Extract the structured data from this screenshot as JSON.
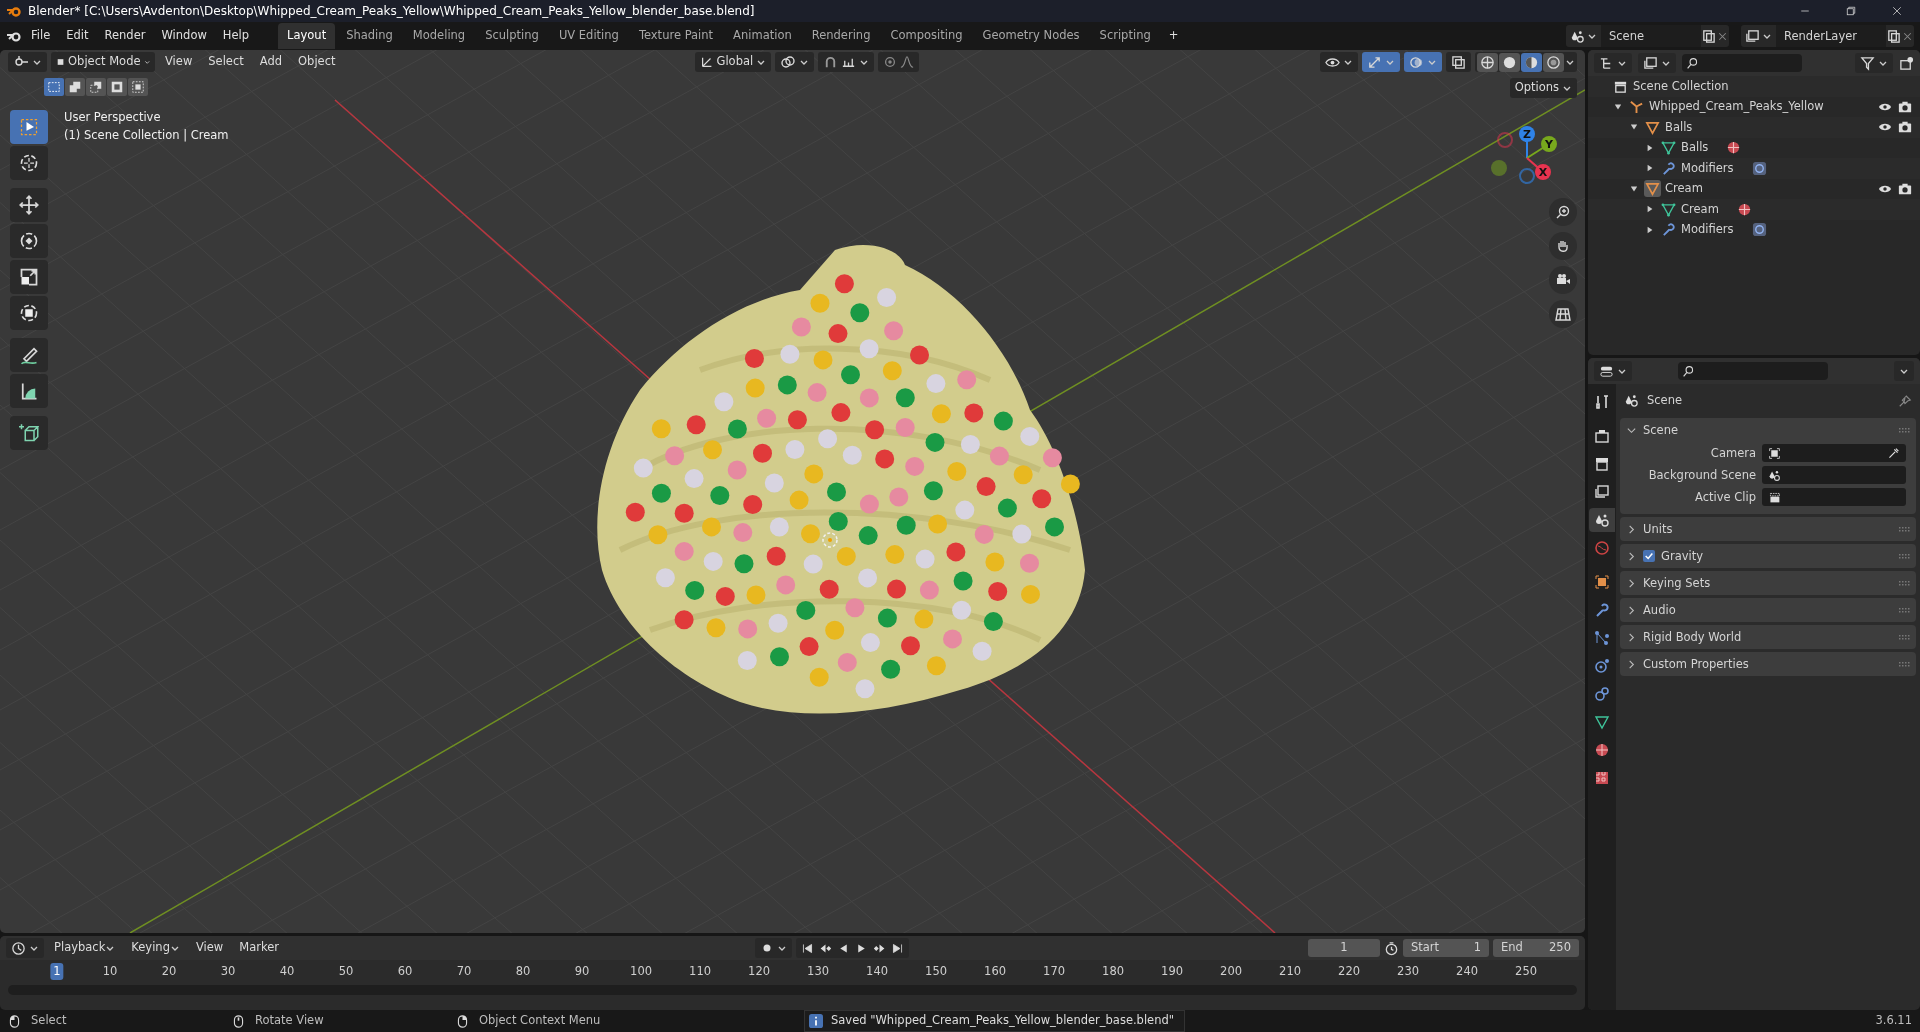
{
  "window": {
    "title": "Blender* [C:\\Users\\Avdenton\\Desktop\\Whipped_Cream_Peaks_Yellow\\Whipped_Cream_Peaks_Yellow_blender_base.blend]"
  },
  "menu": [
    "File",
    "Edit",
    "Render",
    "Window",
    "Help"
  ],
  "workspaces": [
    {
      "label": "Layout",
      "selected": true
    },
    {
      "label": "Shading",
      "selected": false
    },
    {
      "label": "Modeling",
      "selected": false
    },
    {
      "label": "Sculpting",
      "selected": false
    },
    {
      "label": "UV Editing",
      "selected": false
    },
    {
      "label": "Texture Paint",
      "selected": false
    },
    {
      "label": "Animation",
      "selected": false
    },
    {
      "label": "Rendering",
      "selected": false
    },
    {
      "label": "Compositing",
      "selected": false
    },
    {
      "label": "Geometry Nodes",
      "selected": false
    },
    {
      "label": "Scripting",
      "selected": false
    }
  ],
  "workspace_add": "+",
  "scene_selector": {
    "value": "Scene"
  },
  "view_layer_selector": {
    "value": "RenderLayer"
  },
  "viewport": {
    "mode": "Object Mode",
    "menus": [
      "View",
      "Select",
      "Add",
      "Object"
    ],
    "transform_orientation": "Global",
    "options": "Options",
    "select_modes": [
      {
        "kind": "set",
        "selected": true
      },
      {
        "kind": "extend",
        "selected": false
      },
      {
        "kind": "subtract",
        "selected": false
      },
      {
        "kind": "invert",
        "selected": false
      },
      {
        "kind": "intersect",
        "selected": false
      }
    ],
    "toggles": [
      {
        "kind": "gizmos",
        "on": true
      },
      {
        "kind": "overlays",
        "on": true
      },
      {
        "kind": "xray",
        "on": false
      }
    ],
    "shading": [
      {
        "kind": "wireframe",
        "selected": false
      },
      {
        "kind": "solid",
        "selected": false
      },
      {
        "kind": "material",
        "selected": true
      },
      {
        "kind": "rendered",
        "selected": false
      }
    ],
    "overlay_text": [
      "User Perspective",
      "(1) Scene Collection | Cream"
    ],
    "tools": [
      {
        "kind": "select",
        "selected": true
      },
      {
        "kind": "cursor",
        "selected": false
      },
      {
        "kind": "move",
        "selected": false
      },
      {
        "kind": "rotate",
        "selected": false
      },
      {
        "kind": "scale",
        "selected": false
      },
      {
        "kind": "transform",
        "selected": false
      },
      {
        "kind": "annotate",
        "selected": false
      },
      {
        "kind": "measure",
        "selected": false
      },
      {
        "kind": "add-cube",
        "selected": false
      }
    ],
    "gizmo": [
      {
        "label": "Z",
        "color": "#2f83e8"
      },
      {
        "label": "Y",
        "color": "#78a81d"
      },
      {
        "label": "X",
        "color": "#e8334f"
      }
    ]
  },
  "outliner": {
    "items": [
      {
        "label": "Scene Collection",
        "kind": "collection",
        "children": [
          {
            "label": "Whipped_Cream_Peaks_Yellow",
            "kind": "empty",
            "expanded": true,
            "children": [
              {
                "label": "Balls",
                "kind": "mesh-object",
                "expanded": true,
                "active": false,
                "children": [
                  {
                    "label": "Balls",
                    "kind": "mesh-data",
                    "expanded": false
                  },
                  {
                    "label": "Modifiers",
                    "kind": "modifiers",
                    "expanded": false
                  }
                ]
              },
              {
                "label": "Cream",
                "kind": "mesh-object",
                "expanded": true,
                "active": true,
                "children": [
                  {
                    "label": "Cream",
                    "kind": "mesh-data",
                    "expanded": false
                  },
                  {
                    "label": "Modifiers",
                    "kind": "modifiers",
                    "expanded": false
                  }
                ]
              }
            ]
          }
        ]
      }
    ]
  },
  "properties": {
    "tabs": [
      {
        "kind": "tool",
        "selected": false
      },
      {
        "kind": "render",
        "selected": false
      },
      {
        "kind": "output",
        "selected": false
      },
      {
        "kind": "view-layer",
        "selected": false
      },
      {
        "kind": "scene",
        "selected": true
      },
      {
        "kind": "world",
        "selected": false
      },
      {
        "kind": "object",
        "selected": false
      },
      {
        "kind": "modifiers",
        "selected": false
      },
      {
        "kind": "particles",
        "selected": false
      },
      {
        "kind": "physics",
        "selected": false
      },
      {
        "kind": "constraints",
        "selected": false
      },
      {
        "kind": "data",
        "selected": false
      },
      {
        "kind": "material",
        "selected": false
      },
      {
        "kind": "texture",
        "selected": false
      }
    ],
    "context": "Scene",
    "panels": [
      {
        "label": "Scene",
        "kind": "panel",
        "expanded": true,
        "fields": [
          {
            "label": "Camera",
            "kind": "camera"
          },
          {
            "label": "Background Scene",
            "kind": "scene"
          },
          {
            "label": "Active Clip",
            "kind": "clip"
          }
        ]
      },
      {
        "label": "Units",
        "kind": "panel",
        "expanded": false
      },
      {
        "label": "Gravity",
        "kind": "checkbox-panel",
        "expanded": false,
        "checked": true
      },
      {
        "label": "Keying Sets",
        "kind": "panel",
        "expanded": false
      },
      {
        "label": "Audio",
        "kind": "panel",
        "expanded": false
      },
      {
        "label": "Rigid Body World",
        "kind": "panel",
        "expanded": false
      },
      {
        "label": "Custom Properties",
        "kind": "panel",
        "expanded": false
      }
    ]
  },
  "timeline": {
    "menus": [
      "Playback",
      "Keying",
      "View",
      "Marker"
    ],
    "current_frame": "1",
    "start": {
      "label": "Start",
      "value": "1"
    },
    "end": {
      "label": "End",
      "value": "250"
    },
    "ruler": [
      {
        "label": "1",
        "selected": true
      },
      {
        "label": "10",
        "selected": false
      },
      {
        "label": "20",
        "selected": false
      },
      {
        "label": "30",
        "selected": false
      },
      {
        "label": "40",
        "selected": false
      },
      {
        "label": "50",
        "selected": false
      },
      {
        "label": "60",
        "selected": false
      },
      {
        "label": "70",
        "selected": false
      },
      {
        "label": "80",
        "selected": false
      },
      {
        "label": "90",
        "selected": false
      },
      {
        "label": "100",
        "selected": false
      },
      {
        "label": "110",
        "selected": false
      },
      {
        "label": "120",
        "selected": false
      },
      {
        "label": "130",
        "selected": false
      },
      {
        "label": "140",
        "selected": false
      },
      {
        "label": "150",
        "selected": false
      },
      {
        "label": "160",
        "selected": false
      },
      {
        "label": "170",
        "selected": false
      },
      {
        "label": "180",
        "selected": false
      },
      {
        "label": "190",
        "selected": false
      },
      {
        "label": "200",
        "selected": false
      },
      {
        "label": "210",
        "selected": false
      },
      {
        "label": "220",
        "selected": false
      },
      {
        "label": "230",
        "selected": false
      },
      {
        "label": "240",
        "selected": false
      },
      {
        "label": "250",
        "selected": false
      }
    ]
  },
  "status_bar": {
    "hints": [
      {
        "label": "Select",
        "kind": "left"
      },
      {
        "label": "Rotate View",
        "kind": "middle"
      },
      {
        "label": "Object Context Menu",
        "kind": "right"
      }
    ],
    "message": "Saved \"Whipped_Cream_Peaks_Yellow_blender_base.blend\"",
    "version": "3.6.11"
  }
}
